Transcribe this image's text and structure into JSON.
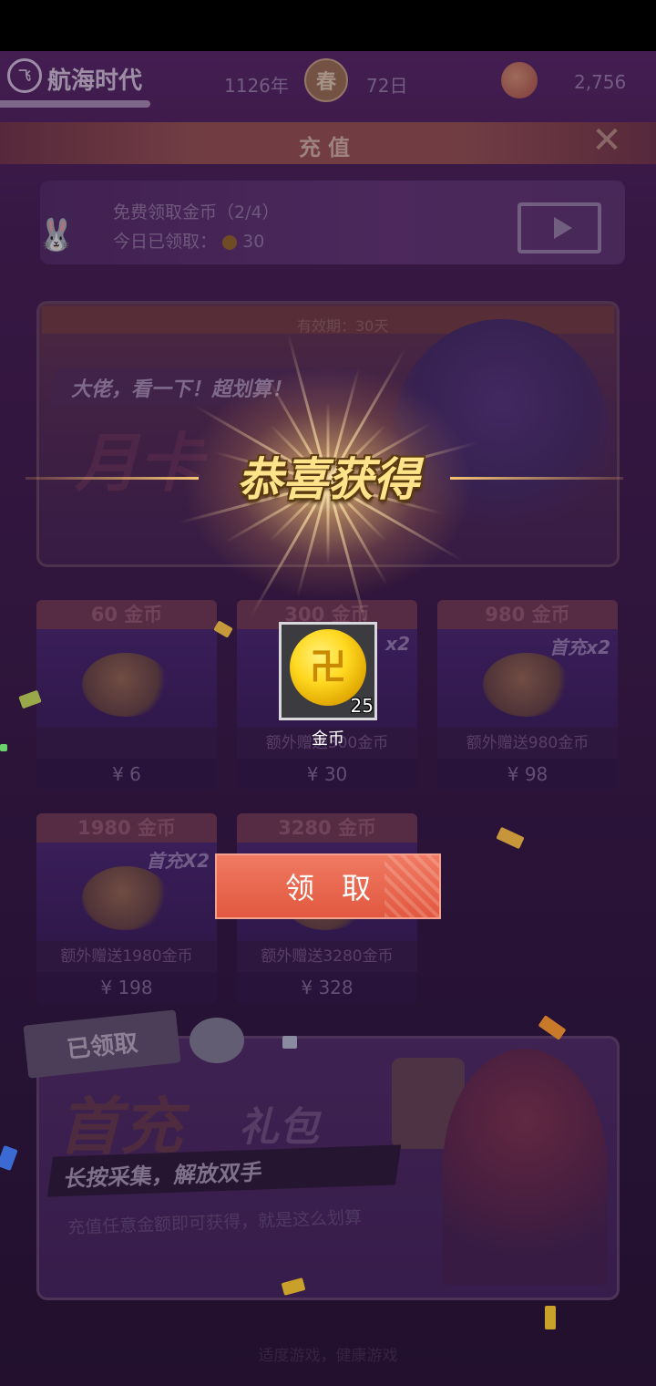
{
  "header": {
    "app_logo": "飞",
    "app_name": "航海时代",
    "year": "1126年",
    "season": "春",
    "day": "72日",
    "coins": "2,756"
  },
  "title_bar": {
    "title": "充值"
  },
  "free_coin": {
    "title": "免费领取金币（2/4）",
    "claimed_today_label": "今日已领取：",
    "claimed_today_value": "30"
  },
  "monthly_card": {
    "validity": "有效期：30天",
    "slogan": "大佬，看一下！超划算！",
    "big_text": "月卡"
  },
  "packages": [
    {
      "title": "60 金币",
      "badge": "",
      "extra": "",
      "price": "¥ 6"
    },
    {
      "title": "300 金币",
      "badge": "x2",
      "extra": "额外赠送300金币",
      "price": "¥ 30"
    },
    {
      "title": "980 金币",
      "badge": "首充x2",
      "extra": "额外赠送980金币",
      "price": "¥ 98"
    },
    {
      "title": "1980 金币",
      "badge": "首充X2",
      "extra": "额外赠送1980金币",
      "price": "¥ 198"
    },
    {
      "title": "3280 金币",
      "badge": "",
      "extra": "额外赠送3280金币",
      "price": "¥ 328"
    }
  ],
  "first_pay": {
    "tag": "已领取",
    "big_text": "首充",
    "gift_text": "礼包",
    "banner": "长按采集，解放双手",
    "desc": "充值任意金额即可获得，就是这么划算"
  },
  "footer": {
    "text": "适度游戏，健康游戏"
  },
  "popup": {
    "congrats": "恭喜获得",
    "item_name": "金币",
    "item_count": "25",
    "claim_button": "领取"
  },
  "colors": {
    "background": "#2c1538",
    "claim_button": "#e8654b",
    "gold_text": "#ffe38a",
    "coin_gold": "#ffd820"
  }
}
